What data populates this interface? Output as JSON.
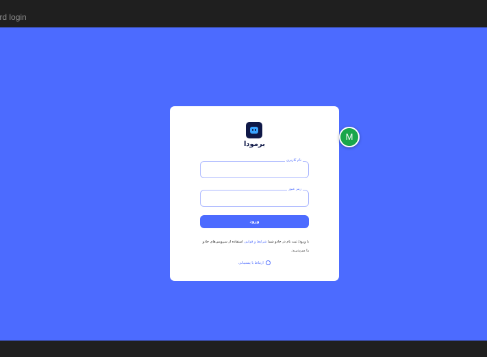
{
  "window": {
    "title": "oard login"
  },
  "colors": {
    "background": "#4c6bff",
    "card": "#ffffff",
    "primary": "#4c6bff",
    "chrome": "#1f1f1f",
    "avatar": "#1aa64b"
  },
  "login": {
    "brand": "برمودا",
    "username_label": "نام کاربری",
    "username_value": "",
    "password_label": "رمز عبور",
    "password_value": "",
    "submit_label": "ورود",
    "terms_prefix": "با ورود/ ثبت نام در جادو شما ",
    "terms_link": "شرایط و قوانین",
    "terms_suffix": " استفاده از سرویس‌های جادو را می‌پذیرید.",
    "support_label": "ارتباط با پشتیبانی",
    "support_icon": "clock-icon"
  },
  "avatar": {
    "initial": "M"
  }
}
